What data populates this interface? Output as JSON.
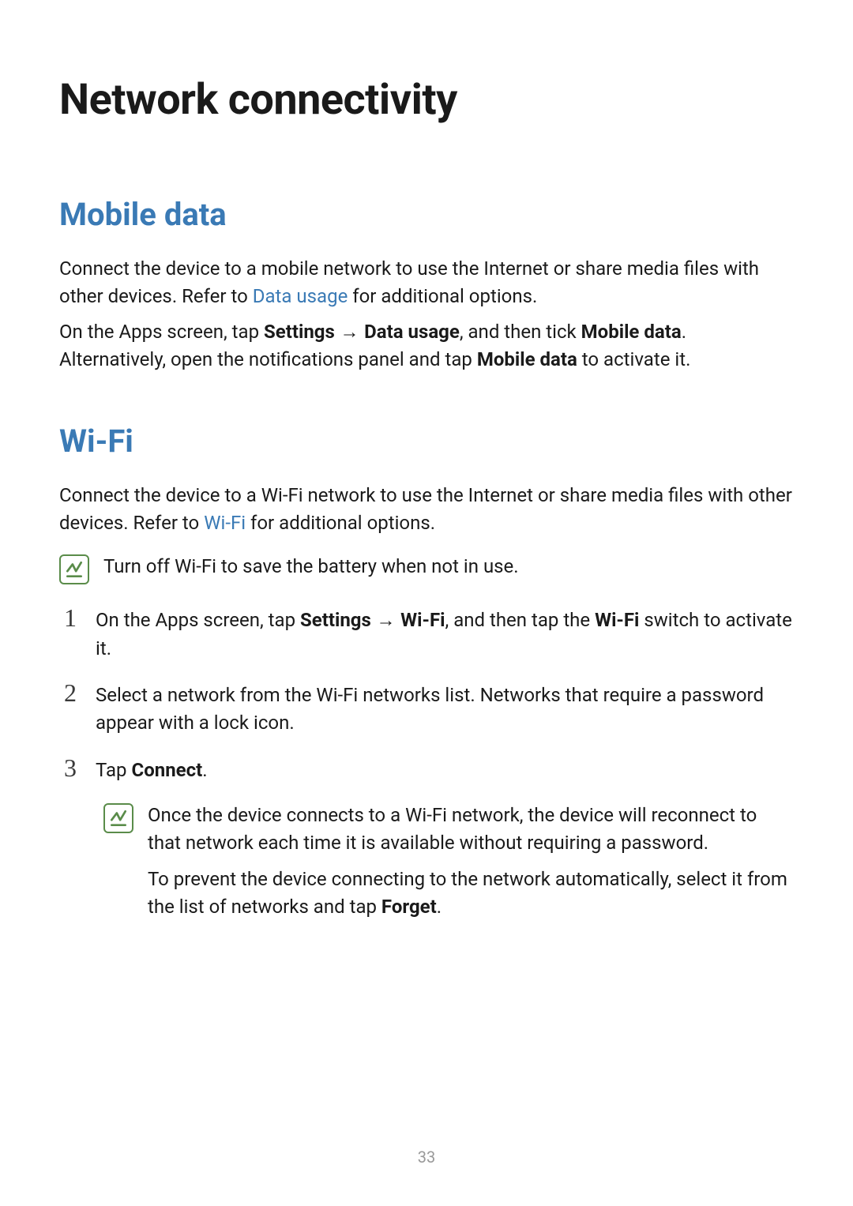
{
  "title": "Network connectivity",
  "sections": {
    "mobileData": {
      "heading": "Mobile data",
      "para1_a": "Connect the device to a mobile network to use the Internet or share media files with other devices. Refer to ",
      "para1_link": "Data usage",
      "para1_b": " for additional options.",
      "para2_a": "On the Apps screen, tap ",
      "para2_settings": "Settings",
      "para2_arrow": " → ",
      "para2_data": "Data usage",
      "para2_b": ", and then tick ",
      "para2_mobile": "Mobile data",
      "para2_c": ". Alternatively, open the notifications panel and tap ",
      "para2_mobile2": "Mobile data",
      "para2_d": " to activate it."
    },
    "wifi": {
      "heading": "Wi-Fi",
      "para1_a": "Connect the device to a Wi-Fi network to use the Internet or share media files with other devices. Refer to ",
      "para1_link": "Wi-Fi",
      "para1_b": " for additional options.",
      "note1": "Turn off Wi-Fi to save the battery when not in use.",
      "steps": {
        "1": {
          "num": "1",
          "a": "On the Apps screen, tap ",
          "settings": "Settings",
          "arrow": " → ",
          "wifi": "Wi-Fi",
          "b": ", and then tap the ",
          "wifi2": "Wi-Fi",
          "c": " switch to activate it."
        },
        "2": {
          "num": "2",
          "text": "Select a network from the Wi-Fi networks list. Networks that require a password appear with a lock icon."
        },
        "3": {
          "num": "3",
          "a": "Tap ",
          "connect": "Connect",
          "b": "."
        }
      },
      "note2_p1": "Once the device connects to a Wi-Fi network, the device will reconnect to that network each time it is available without requiring a password.",
      "note2_p2_a": "To prevent the device connecting to the network automatically, select it from the list of networks and tap ",
      "note2_p2_forget": "Forget",
      "note2_p2_b": "."
    }
  },
  "pageNumber": "33"
}
